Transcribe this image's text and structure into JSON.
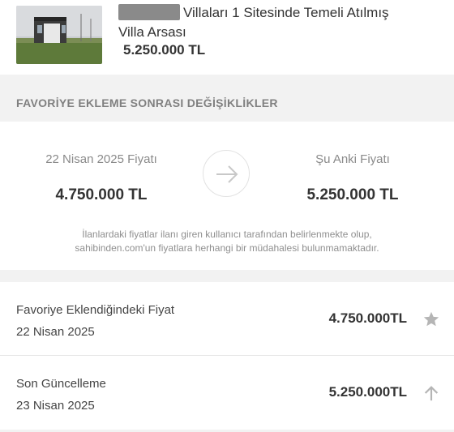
{
  "listing": {
    "title_line1": "Villaları 1 Sitesinde Temeli Atılmış",
    "title_line2": "Villa Arsası",
    "price": "5.250.000 TL"
  },
  "section": {
    "heading": "FAVORİYE EKLEME SONRASI DEĞİŞİKLİKLER"
  },
  "comparison": {
    "old_label": "22 Nisan 2025 Fiyatı",
    "old_price": "4.750.000 TL",
    "new_label": "Şu Anki Fiyatı",
    "new_price": "5.250.000 TL",
    "arrow_icon": "arrow-right-icon",
    "disclaimer_line1": "İlanlardaki fiyatlar ilanı giren kullanıcı tarafından belirlenmekte olup,",
    "disclaimer_line2": "sahibinden.com'un fiyatlara herhangi bir müdahalesi bulunmamaktadır."
  },
  "history": [
    {
      "label": "Favoriye Eklendiğindeki Fiyat",
      "date": "22 Nisan 2025",
      "price": "4.750.000TL",
      "icon": "star-icon"
    },
    {
      "label": "Son Güncelleme",
      "date": "23 Nisan 2025",
      "price": "5.250.000TL",
      "icon": "arrow-up-icon"
    }
  ],
  "colors": {
    "section_bg": "#f2f2f2",
    "muted_text": "#808080",
    "icon_gray": "#b5b5b5"
  }
}
